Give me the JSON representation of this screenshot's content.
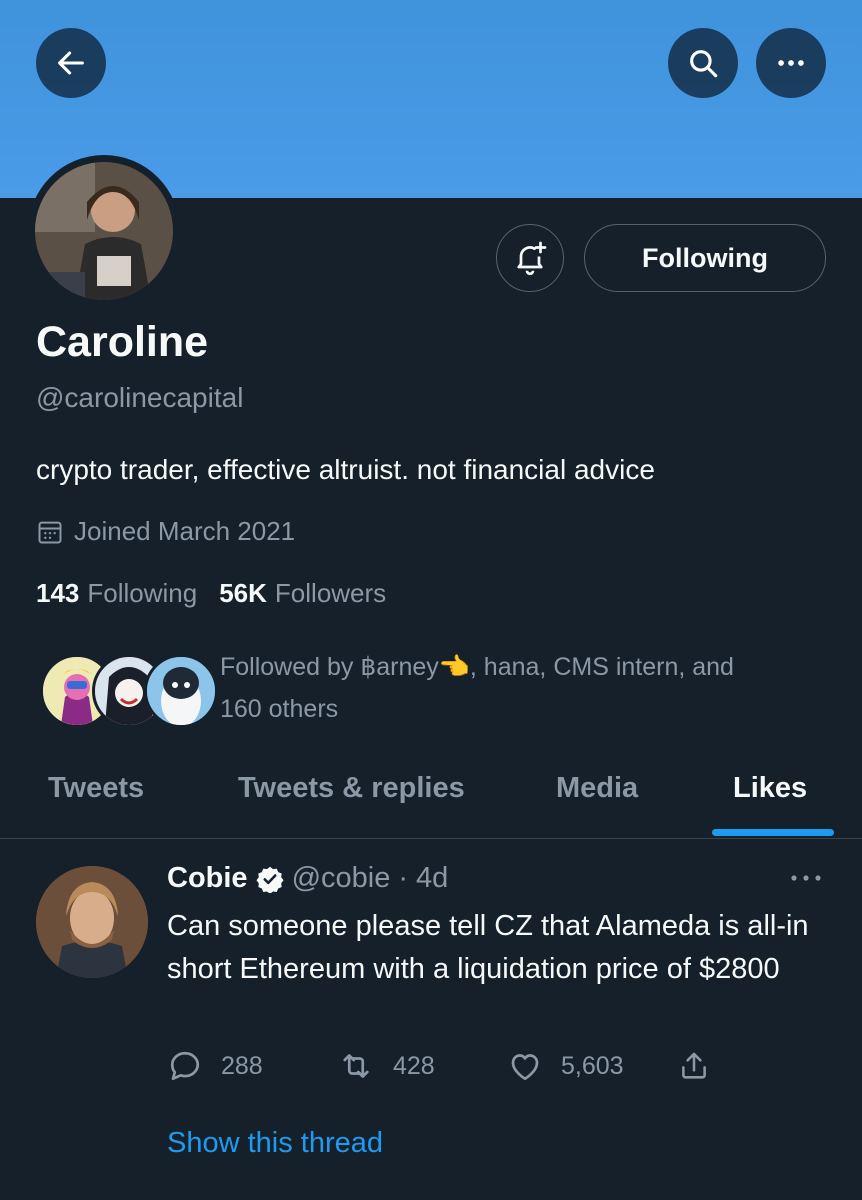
{
  "header": {
    "back_icon": "arrow-left-icon",
    "search_icon": "search-icon",
    "more_icon": "more-horizontal-icon",
    "banner_color": "#4a9be8"
  },
  "profile": {
    "name": "Caroline",
    "handle": "@carolinecapital",
    "bio": "crypto trader, effective altruist. not financial advice",
    "joined": "Joined March 2021",
    "following_count": "143",
    "following_label": "Following",
    "followers_count": "56K",
    "followers_label": "Followers",
    "followed_by_line1": "Followed by ฿arney👈, hana, CMS intern, and",
    "followed_by_line2": "160 others",
    "follow_button_label": "Following"
  },
  "tabs": [
    {
      "label": "Tweets"
    },
    {
      "label": "Tweets & replies"
    },
    {
      "label": "Media"
    },
    {
      "label": "Likes",
      "active": true
    }
  ],
  "tweet": {
    "author": "Cobie",
    "handle": "@cobie",
    "time": "· 4d",
    "verified": true,
    "text": "Can someone please tell CZ that Alameda is all-in short Ethereum with a liquidation price of $2800",
    "replies": "288",
    "retweets": "428",
    "likes": "5,603",
    "show_thread": "Show this thread"
  },
  "colors": {
    "background": "#15202b",
    "accent": "#1d9bf0",
    "muted_text": "#8b98a5",
    "border": "#536471"
  }
}
